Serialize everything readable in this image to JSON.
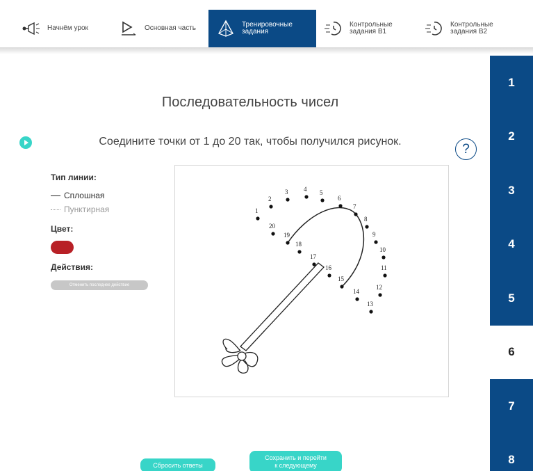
{
  "nav": {
    "tabs": [
      {
        "label": "Начнём урок",
        "icon": "megaphone-icon"
      },
      {
        "label": "Основная часть",
        "icon": "play-board-icon"
      },
      {
        "label": "Тренировочные\nзадания",
        "icon": "pyramid-icon"
      },
      {
        "label": "Контрольные\nзадания В1",
        "icon": "speed-timer-icon"
      },
      {
        "label": "Контрольные\nзадания В2",
        "icon": "speed-timer-icon"
      }
    ],
    "active_index": 2,
    "active_color": "#0b4a86"
  },
  "page": {
    "title": "Последовательность чисел",
    "instruction": "Соедините точки от 1 до 20 так, чтобы получился рисунок.",
    "help_label": "?"
  },
  "panel": {
    "line_type_label": "Тип линии:",
    "solid_label": "Сплошная",
    "dotted_label": "Пунктирная",
    "color_label": "Цвет:",
    "selected_color": "#b82026",
    "actions_label": "Действия:",
    "undo_label": "Отменить последнее действие"
  },
  "puzzle": {
    "points": [
      {
        "n": "1"
      },
      {
        "n": "2"
      },
      {
        "n": "3"
      },
      {
        "n": "4"
      },
      {
        "n": "5"
      },
      {
        "n": "6"
      },
      {
        "n": "7"
      },
      {
        "n": "8"
      },
      {
        "n": "9"
      },
      {
        "n": "10"
      },
      {
        "n": "11"
      },
      {
        "n": "12"
      },
      {
        "n": "13"
      },
      {
        "n": "14"
      },
      {
        "n": "15"
      },
      {
        "n": "16"
      },
      {
        "n": "17"
      },
      {
        "n": "18"
      },
      {
        "n": "19"
      },
      {
        "n": "20"
      }
    ]
  },
  "side_tabs": [
    "1",
    "2",
    "3",
    "4",
    "5",
    "6",
    "7",
    "8"
  ],
  "side_current_index": 5,
  "buttons": {
    "reset_label": "Сбросить ответы",
    "save_label": "Сохранить и перейти\nк следующему",
    "accent": "#38d5c8"
  }
}
